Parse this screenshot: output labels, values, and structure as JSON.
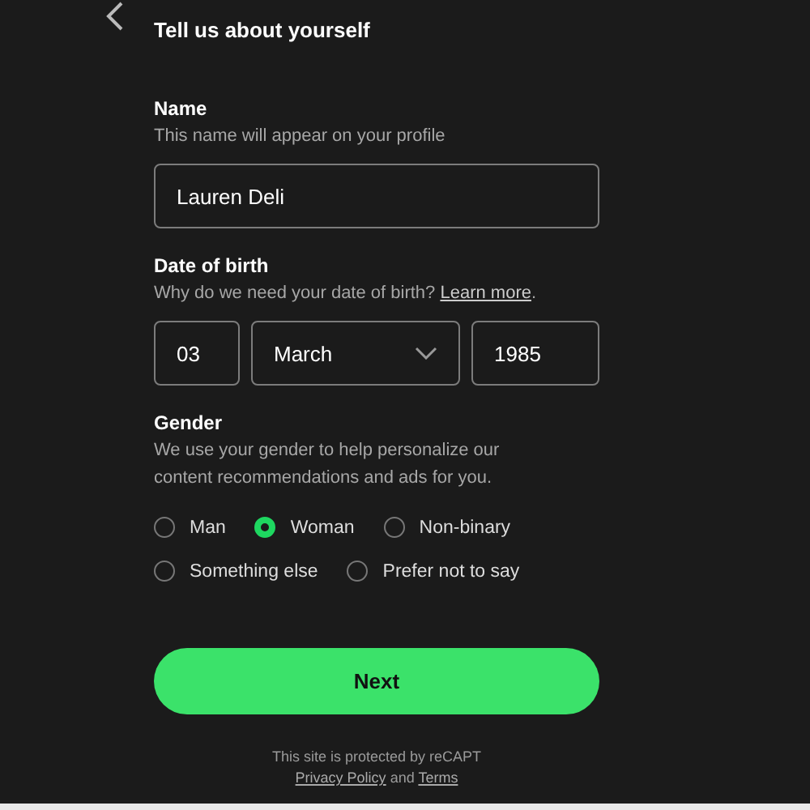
{
  "header": {
    "title": "Tell us about yourself"
  },
  "name": {
    "label": "Name",
    "hint": "This name will appear on your profile",
    "value": "Lauren Deli"
  },
  "date_of_birth": {
    "label": "Date of birth",
    "hint": "Why do we need your date of birth?",
    "link": "Learn more",
    "after_link": ".",
    "day": "03",
    "month": "March",
    "year": "1985"
  },
  "gender": {
    "label": "Gender",
    "hint": "We use your gender to help personalize our content recommendations and ads for you.",
    "options": [
      {
        "label": "Man",
        "selected": false
      },
      {
        "label": "Woman",
        "selected": true
      },
      {
        "label": "Non-binary",
        "selected": false
      },
      {
        "label": "Something else",
        "selected": false
      },
      {
        "label": "Prefer not to say",
        "selected": false
      }
    ]
  },
  "next_button": "Next",
  "footer": {
    "line_1": "This site is protected by reCAPT",
    "link_1": "Privacy Policy",
    "between": "and",
    "link_2": "Terms"
  }
}
